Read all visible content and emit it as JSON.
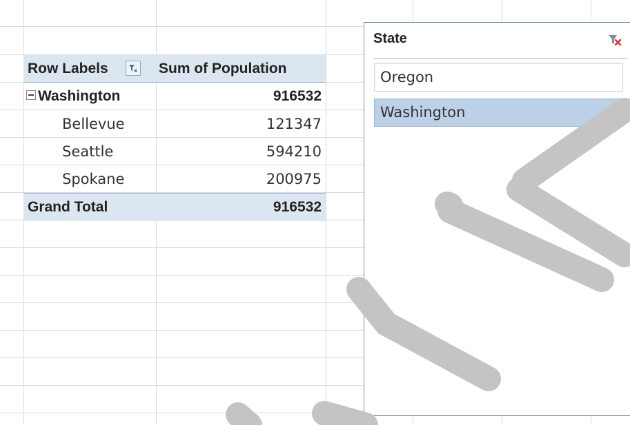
{
  "pivot": {
    "header_label": "Row Labels",
    "header_value": "Sum of Population",
    "group": {
      "name": "Washington",
      "value": "916532"
    },
    "children": [
      {
        "name": "Bellevue",
        "value": "121347"
      },
      {
        "name": "Seattle",
        "value": "594210"
      },
      {
        "name": "Spokane",
        "value": "200975"
      }
    ],
    "total": {
      "label": "Grand Total",
      "value": "916532"
    }
  },
  "slicer": {
    "title": "State",
    "items": [
      {
        "label": "Oregon",
        "selected": false
      },
      {
        "label": "Washington",
        "selected": true
      }
    ],
    "clear_icon": "clear-filter-icon"
  },
  "icons": {
    "row_filter": "filter-dropdown-icon",
    "collapse": "collapse-minus-icon"
  },
  "colors": {
    "header_fill": "#dce6f1",
    "selected_item": "#bcd0e8",
    "gridline": "#dadcdd"
  }
}
